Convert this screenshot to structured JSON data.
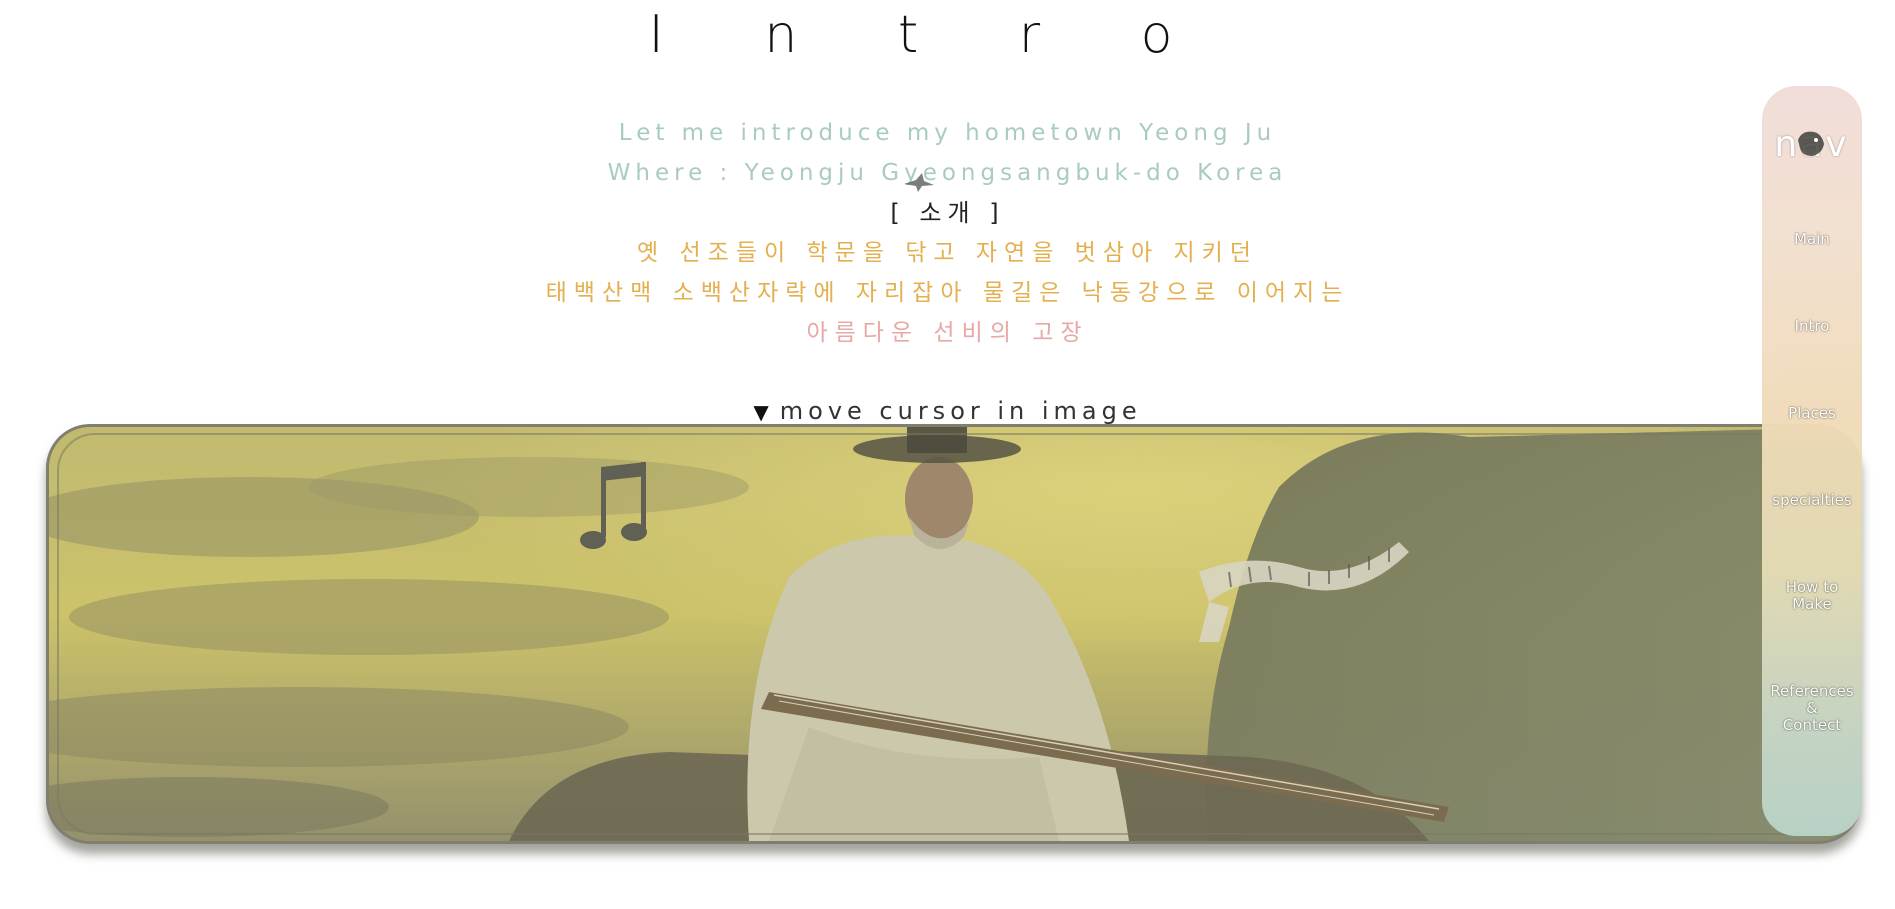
{
  "page": {
    "title": "I n t r o"
  },
  "intro": {
    "line1": "Let me introduce my hometown Yeong Ju",
    "line2": "Where : Yeongju Gyeongsangbuk-do Korea",
    "line3": "[ 소개 ]",
    "line4": "옛 선조들이 학문을 닦고 자연을 벗삼아 지키던",
    "line5": "태백산맥 소백산자락에 자리잡아 물길은 낙동강으로 이어지는",
    "line6": "아름다운 선비의 고장"
  },
  "hint": {
    "arrow": "▼",
    "text": "move cursor in image"
  },
  "image": {
    "alt_icons": [
      "music-note-icon",
      "piano-keys-icon"
    ]
  },
  "nav": {
    "title": "nav",
    "items": [
      {
        "label": "Main"
      },
      {
        "label": "Intro"
      },
      {
        "label": "Places"
      },
      {
        "label": "specialties"
      },
      {
        "label": "How to\nMake"
      },
      {
        "label": "References\n&\nContect"
      }
    ]
  },
  "colors": {
    "teal": "#a9cbc3",
    "gold": "#e4b04f",
    "pink": "#e8a8a6"
  }
}
